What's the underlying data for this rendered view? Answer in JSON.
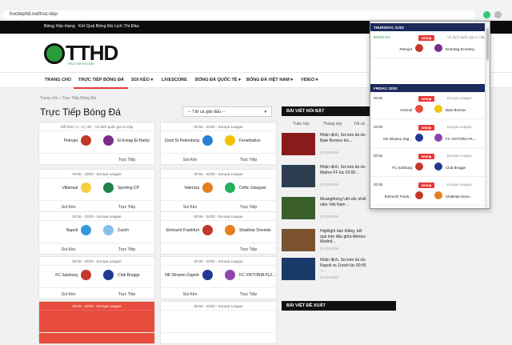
{
  "browser": {
    "url": "tructiephd.net/truc-tiep"
  },
  "topbar": {
    "links": [
      "Bảng Xếp Hạng",
      "Kết Quả Bóng Đá",
      "Lịch Thi Đấu"
    ]
  },
  "logo": {
    "text": "TTHD",
    "sub": "TRUCTIEPHD.NET"
  },
  "nav": {
    "items": [
      "TRANG CHỦ",
      "TRỰC TIẾP BÓNG ĐÁ",
      "SOI KÈO ▾",
      "LIVESCORE",
      "BÓNG ĐÁ QUỐC TẾ ▾",
      "BÓNG ĐÁ VIỆT NAM ▾",
      "VIDEO ▾"
    ]
  },
  "breadcrumb": "Trang chủ » Trực Tiếp Bóng Đá",
  "page_title": "Trực Tiếp Bóng Đá",
  "select": {
    "label": "-- Tất cả giải đấu --",
    "arrow": "▾"
  },
  "matches": [
    {
      "head": "Kết thúc | 1 - 0 | 45' - Vô địch quốc gia Ai Cập",
      "home": "Petrojet",
      "away": "El-Entag El-Harby",
      "footer_left": "",
      "footer_right": "Trực Tiếp",
      "home_color": "#c0392b",
      "away_color": "#7b2d8e"
    },
    {
      "head": "00:55 - 22/02 - Europa League",
      "home": "Zenit St Petersburg",
      "away": "Fenerbahce",
      "footer_left": "Soi Kèo",
      "footer_right": "Trực Tiếp",
      "home_color": "#2a7fd4",
      "away_color": "#f2c200"
    },
    {
      "head": "00:55 - 22/02 - Europa League",
      "home": "Villarreal",
      "away": "Sporting CP",
      "footer_left": "Soi Kèo",
      "footer_right": "Trực Tiếp",
      "home_color": "#f4d03f",
      "away_color": "#1e8449"
    },
    {
      "head": "00:55 - 22/02 - Europa League",
      "home": "Valencia",
      "away": "Celtic Glasgow",
      "footer_left": "Soi Kèo",
      "footer_right": "Trực Tiếp",
      "home_color": "#e67e22",
      "away_color": "#27ae60"
    },
    {
      "head": "00:55 - 22/02 - Europa League",
      "home": "Napoli",
      "away": "Zurich",
      "footer_left": "Soi Kèo",
      "footer_right": "Trực Tiếp",
      "home_color": "#3498db",
      "away_color": "#85c1e9"
    },
    {
      "head": "00:55 - 22/02 - Europa League",
      "home": "Eintracht Frankfurt",
      "away": "Shakhtar Donetsk",
      "footer_left": "",
      "footer_right": "Trực Tiếp",
      "home_color": "#c0392b",
      "away_color": "#e67e22"
    },
    {
      "head": "00:55 - 22/02 - Europa League",
      "home": "FC Salzburg",
      "away": "Club Brugge",
      "footer_left": "Soi Kèo",
      "footer_right": "Trực Tiếp",
      "home_color": "#c0392b",
      "away_color": "#1f3a93"
    },
    {
      "head": "00:55 - 22/02 - Europa League",
      "home": "NK Dinamo Zagreb",
      "away": "FC VIKTORIA PLZ...",
      "footer_left": "Soi Kèo",
      "footer_right": "Trực Tiếp",
      "home_color": "#1f3a93",
      "away_color": "#8e44ad"
    },
    {
      "head": "00:55 - 22/02 - Europa League",
      "home": "",
      "away": "",
      "footer_left": "",
      "footer_right": "",
      "home_color": "#ffffff",
      "away_color": "#ffffff"
    },
    {
      "head": "00:55 - 22/02 - Europa League",
      "home": "",
      "away": "",
      "footer_left": "",
      "footer_right": "",
      "home_color": "#ffffff",
      "away_color": "#ffffff"
    }
  ],
  "sidebar": {
    "featured_title": "BÀI VIẾT NỔI BẬT",
    "tabs": [
      "Tuần này",
      "Tháng này",
      "Tất cả"
    ],
    "news": [
      {
        "title": "Nhận định, Soi kèo tài xỉu Bate Borisov lúc...",
        "meta": "21-02-2019"
      },
      {
        "title": "Nhận định, Soi kèo tài xỉu Malmo FF lúc 03:00...",
        "meta": "21-02-2019"
      },
      {
        "title": "Muangthong Utd sắc nhất năm Việt Nam ...",
        "meta": "21-02-2019"
      },
      {
        "title": "Highlight bàn thắng, kết quả trận đấu giữa Atletico Madrid...",
        "meta": "21-02-2019"
      },
      {
        "title": "Nhận định, Soi kèo tài xỉu Napoli vs Zurich lúc 00:55 -...",
        "meta": "21-02-2019"
      }
    ],
    "recommended_title": "BÀI VIẾT ĐỀ XUẤT"
  },
  "popup": {
    "days": [
      "THURSDAY, 21/02",
      "FRIDAY, 22/02"
    ],
    "xem_label": "XEM ▶",
    "rows": [
      {
        "time": "",
        "league": "Vô địch quốc gia Ai Cập",
        "home": "Petrojet",
        "away": "El-Entag El-Harby",
        "hc": "#c0392b",
        "ac": "#7b2d8e"
      },
      {
        "time": "00:55",
        "league": "Europa League",
        "home": "Arsenal",
        "away": "Bate Borisov",
        "hc": "#e74c3c",
        "ac": "#f1c40f"
      },
      {
        "time": "00:55",
        "league": "Europa League",
        "home": "NK Dinamo Zag...",
        "away": "FC VIKTORIA PL...",
        "hc": "#1f3a93",
        "ac": "#8e44ad"
      },
      {
        "time": "00:55",
        "league": "Europa League",
        "home": "FC Salzburg",
        "away": "Club Brugge",
        "hc": "#c0392b",
        "ac": "#1f3a93"
      },
      {
        "time": "00:55",
        "league": "Europa League",
        "home": "Eintracht Frank...",
        "away": "Shakhtar Done...",
        "hc": "#c0392b",
        "ac": "#e67e22"
      },
      {
        "time": "00:55",
        "league": "Europa League",
        "home": "",
        "away": "",
        "hc": "#ffffff",
        "ac": "#ffffff"
      }
    ],
    "live_label": "BÓNG ĐÁ"
  }
}
